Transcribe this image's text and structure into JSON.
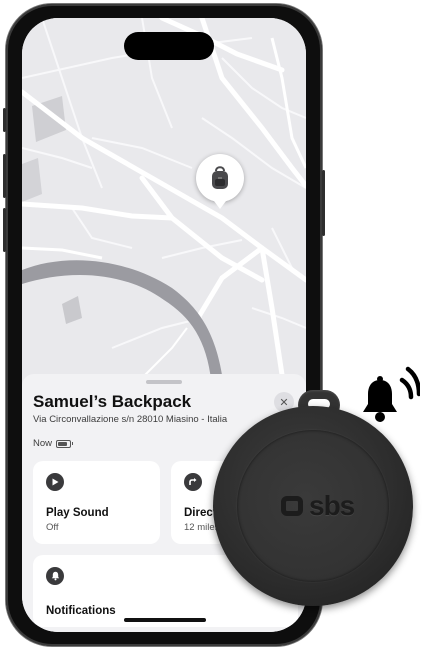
{
  "item": {
    "name": "Samuel’s Backpack",
    "address": "Via Circonvallazione s/n 28010 Miasino - Italia",
    "status_time": "Now"
  },
  "actions": [
    {
      "label": "Play Sound",
      "value": "Off",
      "icon": "play-icon"
    },
    {
      "label": "Directions",
      "value": "12 miles",
      "icon": "directions-arrow-icon"
    },
    {
      "label": "Notifications",
      "icon": "bell-icon"
    }
  ],
  "tag_device": {
    "brand": "sbs"
  },
  "icons": {
    "pin": "backpack-icon",
    "close": "close-icon",
    "battery": "battery-icon",
    "alert": "ringing-bell-icon"
  },
  "colors": {
    "map_background": "#e9e9ec",
    "road": "#ffffff",
    "river": "#9b9ba1",
    "sheet_background": "#f2f2f4",
    "card_background": "#ffffff",
    "icon_fill": "#3a3a3c"
  }
}
